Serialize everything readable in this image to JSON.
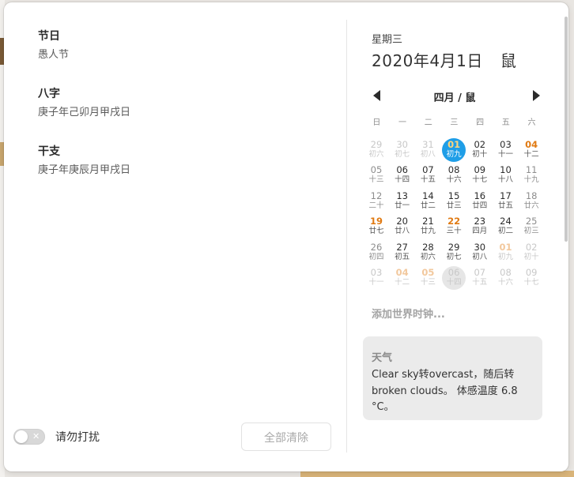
{
  "left": {
    "sections": [
      {
        "title": "节日",
        "value": "愚人节"
      },
      {
        "title": "八字",
        "value": "庚子年己卯月甲戌日"
      },
      {
        "title": "干支",
        "value": "庚子年庚辰月甲戌日"
      }
    ],
    "dnd_label": "请勿打扰",
    "dnd_on": false,
    "clear_all_label": "全部清除"
  },
  "right": {
    "weekday": "星期三",
    "date": "2020年4月1日",
    "zodiac": "鼠",
    "calendar": {
      "title": "四月 / 鼠",
      "weekdays": [
        "日",
        "一",
        "二",
        "三",
        "四",
        "五",
        "六"
      ],
      "weeks": [
        [
          {
            "d": "29",
            "l": "初六",
            "t": "other"
          },
          {
            "d": "30",
            "l": "初七",
            "t": "other"
          },
          {
            "d": "31",
            "l": "初八",
            "t": "other"
          },
          {
            "d": "01",
            "l": "初九",
            "t": "today"
          },
          {
            "d": "02",
            "l": "初十",
            "t": ""
          },
          {
            "d": "03",
            "l": "十一",
            "t": ""
          },
          {
            "d": "04",
            "l": "十二",
            "t": "holiday"
          }
        ],
        [
          {
            "d": "05",
            "l": "十三",
            "t": "weekend"
          },
          {
            "d": "06",
            "l": "十四",
            "t": ""
          },
          {
            "d": "07",
            "l": "十五",
            "t": ""
          },
          {
            "d": "08",
            "l": "十六",
            "t": ""
          },
          {
            "d": "09",
            "l": "十七",
            "t": ""
          },
          {
            "d": "10",
            "l": "十八",
            "t": ""
          },
          {
            "d": "11",
            "l": "十九",
            "t": "weekend"
          }
        ],
        [
          {
            "d": "12",
            "l": "二十",
            "t": "weekend"
          },
          {
            "d": "13",
            "l": "廿一",
            "t": ""
          },
          {
            "d": "14",
            "l": "廿二",
            "t": ""
          },
          {
            "d": "15",
            "l": "廿三",
            "t": ""
          },
          {
            "d": "16",
            "l": "廿四",
            "t": ""
          },
          {
            "d": "17",
            "l": "廿五",
            "t": ""
          },
          {
            "d": "18",
            "l": "廿六",
            "t": "weekend"
          }
        ],
        [
          {
            "d": "19",
            "l": "廿七",
            "t": "holiday"
          },
          {
            "d": "20",
            "l": "廿八",
            "t": ""
          },
          {
            "d": "21",
            "l": "廿九",
            "t": ""
          },
          {
            "d": "22",
            "l": "三十",
            "t": "holiday"
          },
          {
            "d": "23",
            "l": "四月",
            "t": ""
          },
          {
            "d": "24",
            "l": "初二",
            "t": ""
          },
          {
            "d": "25",
            "l": "初三",
            "t": "weekend"
          }
        ],
        [
          {
            "d": "26",
            "l": "初四",
            "t": "weekend"
          },
          {
            "d": "27",
            "l": "初五",
            "t": ""
          },
          {
            "d": "28",
            "l": "初六",
            "t": ""
          },
          {
            "d": "29",
            "l": "初七",
            "t": ""
          },
          {
            "d": "30",
            "l": "初八",
            "t": ""
          },
          {
            "d": "01",
            "l": "初九",
            "t": "other holiday"
          },
          {
            "d": "02",
            "l": "初十",
            "t": "other"
          }
        ],
        [
          {
            "d": "03",
            "l": "十一",
            "t": "other"
          },
          {
            "d": "04",
            "l": "十二",
            "t": "other holiday"
          },
          {
            "d": "05",
            "l": "十三",
            "t": "other holiday"
          },
          {
            "d": "06",
            "l": "十四",
            "t": "other sel"
          },
          {
            "d": "07",
            "l": "十五",
            "t": "other"
          },
          {
            "d": "08",
            "l": "十六",
            "t": "other"
          },
          {
            "d": "09",
            "l": "十七",
            "t": "other"
          }
        ]
      ]
    },
    "add_world_clock": "添加世界时钟...",
    "weather": {
      "title": "天气",
      "description": "Clear sky转overcast，随后转broken clouds。 体感温度 6.8 °C。"
    }
  }
}
